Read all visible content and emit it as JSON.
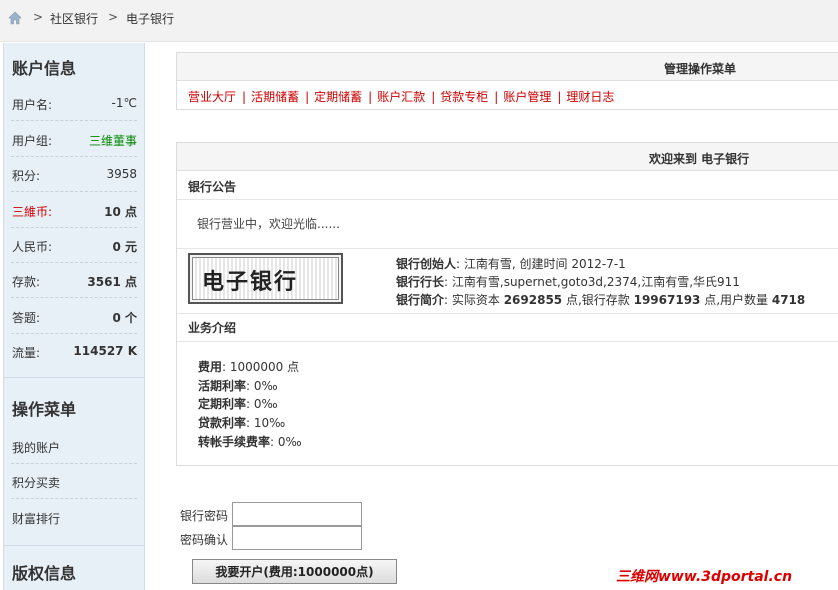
{
  "breadcrumb": {
    "separator": ">",
    "items": [
      "社区银行",
      "电子银行"
    ]
  },
  "sidebar": {
    "account_title": "账户信息",
    "account_rows": [
      {
        "label": "用户名:",
        "value": "-1℃"
      },
      {
        "label": "用户组:",
        "value": "三维董事"
      },
      {
        "label": "积分:",
        "value": "3958"
      },
      {
        "label": "三維币:",
        "value": "10 点"
      },
      {
        "label": "人民币:",
        "value": "0 元"
      },
      {
        "label": "存款:",
        "value": "3561 点"
      },
      {
        "label": "答题:",
        "value": "0 个"
      },
      {
        "label": "流量:",
        "value": "114527 K"
      }
    ],
    "menu_title": "操作菜单",
    "menu_items": [
      "我的账户",
      "积分买卖",
      "财富排行"
    ],
    "copyright_title": "版权信息"
  },
  "menu_panel": {
    "title": "管理操作菜单",
    "items": [
      "营业大厅",
      "活期储蓄",
      "定期储蓄",
      "账户汇款",
      "贷款专柜",
      "账户管理",
      "理财日志"
    ]
  },
  "bank_panel": {
    "title": "欢迎来到 电子银行",
    "notice_title": "银行公告",
    "notice_text": "银行营业中，欢迎光临......",
    "logo_text": "电子银行",
    "founder_label": "银行创始人",
    "founder_value": ": 江南有雪, 创建时间  2012-7-1",
    "president_label": "银行行长",
    "president_value": ": 江南有雪,supernet,goto3d,2374,江南有雪,华氏911",
    "intro_label": "银行简介",
    "intro_a": ": 实际资本 ",
    "intro_capital": "2692855",
    "intro_b": " 点,银行存款 ",
    "intro_deposit": "19967193",
    "intro_c": " 点,用户数量 ",
    "intro_users": "4718",
    "business_title": "业务介绍",
    "fees": [
      {
        "label": "费用",
        "value": ": 1000000 点"
      },
      {
        "label": "活期利率",
        "value": ": 0‰"
      },
      {
        "label": "定期利率",
        "value": ": 0‰"
      },
      {
        "label": "贷款利率",
        "value": ": 10‰"
      },
      {
        "label": "转帐手续费率",
        "value": ": 0‰"
      }
    ]
  },
  "form": {
    "password_label": "银行密码",
    "password_value": "",
    "confirm_label": "密码确认",
    "confirm_value": "",
    "submit_label": "我要开户(费用:1000000点)"
  },
  "watermark": "三维网www.3dportal.cn",
  "colors": {
    "accent_red": "#cc0000",
    "group_green": "#008800",
    "sidebar_bg": "#e8f0f7"
  }
}
